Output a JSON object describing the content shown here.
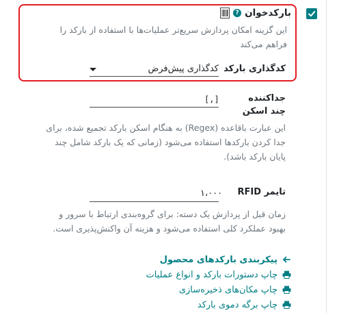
{
  "barcode_setting": {
    "title": "بارکدخوان",
    "help_icon": "help-circle-icon",
    "help_symbol": "?",
    "icon": "barcode-icon",
    "description": "این گزینه امکان پردازش سریع‌تر عملیات‌ها با استفاده از بارکد را فراهم می‌کند",
    "checked": true
  },
  "encoding": {
    "label": "کدگذاری بارکد",
    "value": "کدگذاری پیش‌فرض"
  },
  "separator": {
    "label_line1": "جداکننده",
    "label_line2": "چند اسکن",
    "value": "[,]",
    "description": "این عبارت باقاعده (Regex) به هنگام اسکن بارکد تجمیع شده، برای جدا کردن بارکدها استفاده می‌شود (زمانی که یک بارکد شامل چند پایان بارکد باشد)."
  },
  "rfid_timer": {
    "label": "تایمر RFID",
    "value": "۱،۰۰۰",
    "description": "زمان قبل از پردازش یک دسته: برای گروه‌بندی ارتباط با سرور و بهبود عملکرد کلی استفاده می‌شود و هزینه آن واکنش‌پذیری است."
  },
  "links": [
    {
      "label": "پیکربندی بارکدهای محصول",
      "icon": "arrow-left-icon"
    },
    {
      "label": "چاپ دستورات بارکد و انواع عملیات",
      "icon": "printer-icon"
    },
    {
      "label": "چاپ مکان‌های ذخیره‌سازی",
      "icon": "printer-icon"
    },
    {
      "label": "چاپ برگه دموی بارکد",
      "icon": "printer-icon"
    }
  ],
  "colors": {
    "accent": "#017e84",
    "highlight": "#e41b23"
  }
}
